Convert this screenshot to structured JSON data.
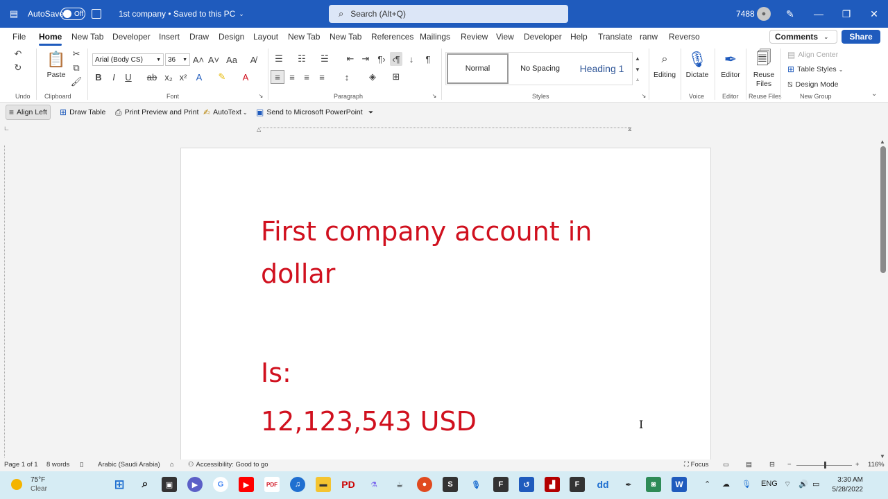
{
  "titlebar": {
    "app_icon": "word-icon",
    "autosave_label": "AutoSave",
    "autosave_state": "Off",
    "doc_title": "1st company • Saved to this PC",
    "search_placeholder": "Search (Alt+Q)",
    "user_id": "7488"
  },
  "tabs": [
    "File",
    "Home",
    "New Tab",
    "Developer",
    "Insert",
    "Draw",
    "Design",
    "Layout",
    "New Tab",
    "New Tab",
    "References",
    "Mailings",
    "Review",
    "View",
    "Developer",
    "Help",
    "Translate",
    "ranw",
    "Reverso"
  ],
  "active_tab": "Home",
  "comments_label": "Comments",
  "share_label": "Share",
  "ribbon": {
    "groups": {
      "undo": "Undo",
      "clipboard": "Clipboard",
      "font": "Font",
      "paragraph": "Paragraph",
      "styles": "Styles",
      "voice": "Voice",
      "editor": "Editor",
      "reuse_files": "Reuse Files",
      "new_group": "New Group"
    },
    "paste_label": "Paste",
    "font_name": "Arial (Body CS)",
    "font_size": "36",
    "styles": [
      "Normal",
      "No Spacing",
      "Heading 1"
    ],
    "editing_label": "Editing",
    "dictate_label": "Dictate",
    "editor_label": "Editor",
    "reuse_files_label": "Reuse Files",
    "align_center_label": "Align Center",
    "table_styles_label": "Table Styles",
    "design_mode_label": "Design Mode"
  },
  "qat": {
    "align_left": "Align Left",
    "draw_table": "Draw Table",
    "print_preview": "Print Preview and Print",
    "autotext": "AutoText",
    "send_ppt": "Send to Microsoft PowerPoint"
  },
  "document": {
    "line1": "First company account in",
    "line2": "dollar",
    "line3": "Is:",
    "line4": "12,123,543 USD",
    "text_color": "#d0101e"
  },
  "status": {
    "page": "Page 1 of 1",
    "words": "8 words",
    "language": "Arabic (Saudi Arabia)",
    "accessibility": "Accessibility: Good to go",
    "focus": "Focus",
    "zoom": "116%"
  },
  "taskbar": {
    "temperature": "75°F",
    "condition": "Clear",
    "language": "ENG",
    "time": "3:30 AM",
    "date": "5/28/2022"
  },
  "colors": {
    "accent": "#1f5bbd",
    "document_text": "#d0101e"
  }
}
